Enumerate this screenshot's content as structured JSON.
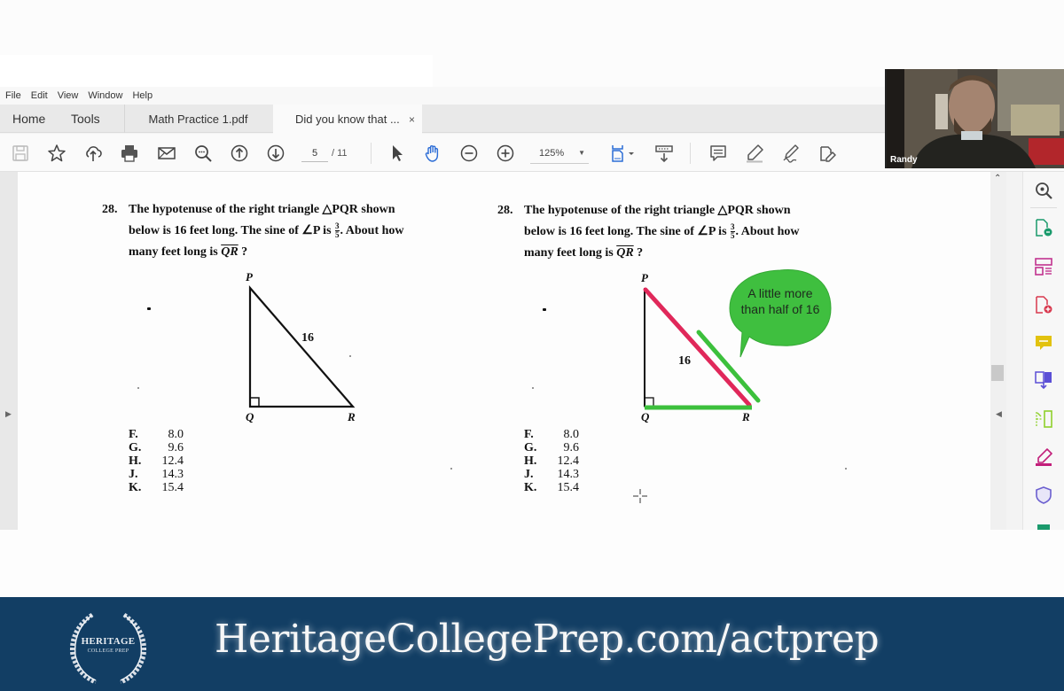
{
  "menu": [
    "File",
    "Edit",
    "View",
    "Window",
    "Help"
  ],
  "tabs": {
    "home": "Home",
    "tools": "Tools",
    "doc1": "Math Practice 1.pdf",
    "doc2": "Did you know that ...",
    "close": "×"
  },
  "toolbar": {
    "icons": [
      "save-icon",
      "bookmark-star-icon",
      "upload-cloud-icon",
      "print-icon",
      "email-icon",
      "search-zoom-icon",
      "page-up-icon",
      "page-down-icon",
      "select-cursor-icon",
      "hand-tool-icon",
      "zoom-out-icon",
      "zoom-in-icon",
      "fit-page-icon",
      "scroll-mode-icon",
      "comment-icon",
      "highlight-icon",
      "sign-icon",
      "fill-sign-icon"
    ],
    "current_page": "5",
    "total_pages": "/ 11",
    "zoom_level": "125%"
  },
  "right_panel": {
    "icons": [
      "zoom-search-icon",
      "export-pdf-icon",
      "organize-pages-icon",
      "create-pdf-icon",
      "comment-icon",
      "combine-files-icon",
      "compress-pdf-icon",
      "fill-sign-icon",
      "protect-shield-icon",
      "more-tools-icon"
    ],
    "colors": [
      "#444444",
      "#1a9a6c",
      "#c2338f",
      "#d8394e",
      "#e2c20f",
      "#5b4fd6",
      "#8fd12c",
      "#c21f7a",
      "#6b5fcf",
      "#1a9a6c"
    ]
  },
  "problem": {
    "number": "28.",
    "line1": "The hypotenuse of the right triangle △PQR shown",
    "line2_a": "below is 16 feet long. The sine of ∠P is",
    "sin_num": "3",
    "sin_den": "5",
    "line2_b": ". About how",
    "line3_a": "many feet long is",
    "segment": "QR",
    "line3_b": " ?",
    "vertex_p": "P",
    "vertex_q": "Q",
    "vertex_r": "R",
    "hypotenuse": "16",
    "choices": [
      {
        "letter": "F.",
        "value": "8.0"
      },
      {
        "letter": "G.",
        "value": "9.6"
      },
      {
        "letter": "H.",
        "value": "12.4"
      },
      {
        "letter": "J.",
        "value": "14.3"
      },
      {
        "letter": "K.",
        "value": "15.4"
      }
    ]
  },
  "annotation": {
    "bubble_text": "A little more than half of 16",
    "hypotenuse_color": "#e0285a",
    "highlight_color": "#3cc03c",
    "bubble_color": "#3fbf3f"
  },
  "webcam": {
    "name": "Randy"
  },
  "banner": {
    "url": "HeritageCollegePrep.com/actprep",
    "logo_line1": "HERITAGE",
    "logo_line2": "COLLEGE PREP",
    "background": "#123e64"
  }
}
